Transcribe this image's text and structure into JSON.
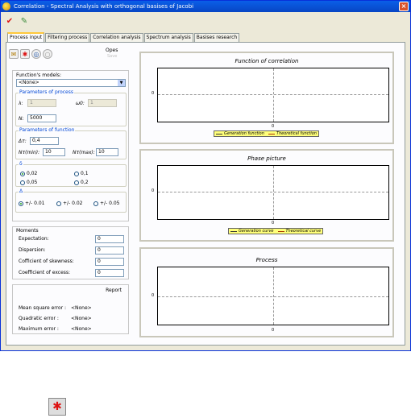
{
  "window": {
    "title": "Correlation - Spectral Analysis with orthogonal basises of Jacobi"
  },
  "toolbar": {
    "icons": [
      "check-icon",
      "pencil-icon"
    ]
  },
  "tabs": [
    {
      "label": "Process input"
    },
    {
      "label": "Filtering process"
    },
    {
      "label": "Correlation analysis"
    },
    {
      "label": "Spectrum analysis"
    },
    {
      "label": "Basises research"
    }
  ],
  "opes": {
    "label": "Opes",
    "sub": "Save"
  },
  "models": {
    "label": "Function's models:",
    "selected": "<None>"
  },
  "process_params": {
    "title": "Parameters of process",
    "lambda_label": "λ:",
    "lambda_value": "1",
    "omega_label": "ω0:",
    "omega_value": "1",
    "n_label": "N:",
    "n_value": "5000"
  },
  "function_params": {
    "title": "Parameters of function",
    "dtau_label": "Δτ:",
    "dtau_value": "0,4",
    "nmin_label": "Nτ(min):",
    "nmin_value": "10",
    "nmax_label": "Nτ(max):",
    "nmax_value": "10"
  },
  "delta_group": {
    "title": "δ",
    "options": [
      "0,02",
      "0,1",
      "0,05",
      "0,2"
    ]
  },
  "tolerance_group": {
    "title": "Δ",
    "options": [
      "+/- 0.01",
      "+/- 0.02",
      "+/- 0.05"
    ]
  },
  "moments": {
    "title": "Moments",
    "rows": [
      {
        "label": "Expectation:",
        "value": "0"
      },
      {
        "label": "Dispersion:",
        "value": "0"
      },
      {
        "label": "Cofficient of skewness:",
        "value": "0"
      },
      {
        "label": "Coefficient of excess:",
        "value": "0"
      }
    ]
  },
  "report": {
    "title": "Report",
    "rows": [
      {
        "label": "Mean square error :",
        "value": "<None>"
      },
      {
        "label": "Quadratic error :",
        "value": "<None>"
      },
      {
        "label": "Maximum error :",
        "value": "<None>"
      }
    ]
  },
  "graphs": [
    {
      "title": "Function of correlation",
      "y0": "0",
      "x0": "0",
      "legend": [
        "Generation function",
        "Theoretical function"
      ]
    },
    {
      "title": "Phase picture",
      "y0": "0",
      "x0": "0",
      "legend": [
        "Generation curve",
        "Theoretical curve"
      ]
    },
    {
      "title": "Process",
      "y0": "0",
      "x0": "0"
    }
  ],
  "colors": {
    "title_bar": "#0a5fe8",
    "window_bg": "#ece9d8",
    "legend_bg": "#ffff7a"
  }
}
